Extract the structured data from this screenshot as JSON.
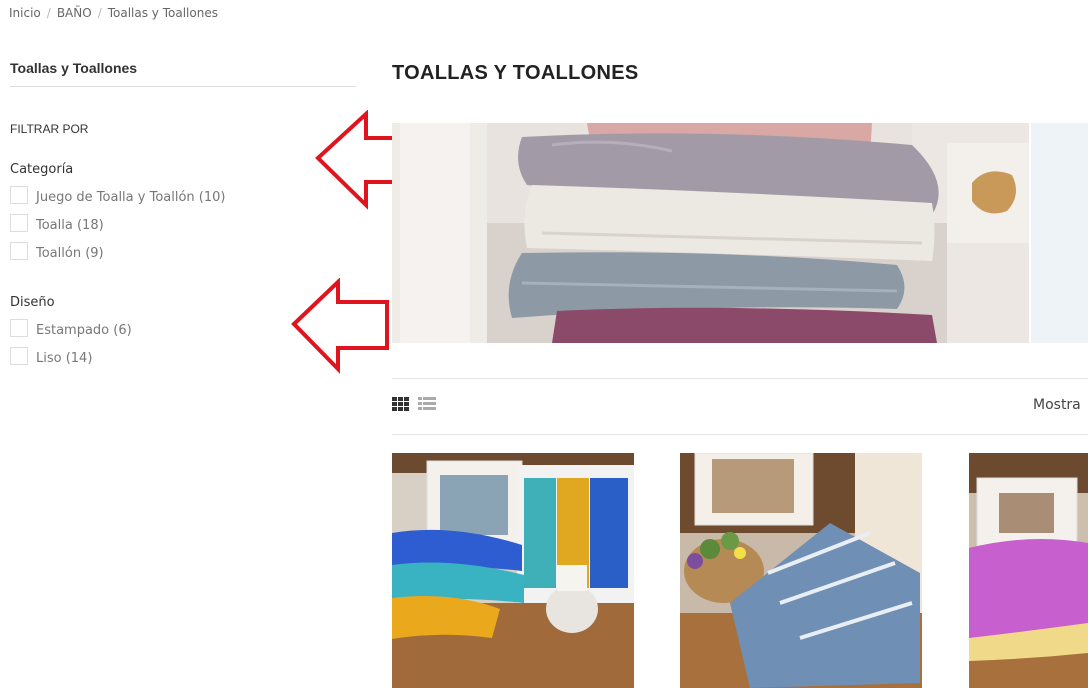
{
  "breadcrumb": {
    "items": [
      "Inicio",
      "BAÑO",
      "Toallas y Toallones"
    ],
    "separator": "/"
  },
  "sidebar": {
    "title": "Toallas y Toallones",
    "filter_heading": "FILTRAR POR",
    "groups": [
      {
        "label": "Categoría",
        "options": [
          {
            "label": "Juego de Toalla y Toallón (10)",
            "checked": false
          },
          {
            "label": "Toalla (18)",
            "checked": false
          },
          {
            "label": "Toallón (9)",
            "checked": false
          }
        ]
      },
      {
        "label": "Diseño",
        "options": [
          {
            "label": "Estampado (6)",
            "checked": false
          },
          {
            "label": "Liso (14)",
            "checked": false
          }
        ]
      }
    ]
  },
  "annotations": {
    "arrow_color": "#e0141e"
  },
  "main": {
    "title": "TOALLAS Y TOALLONES",
    "toolbar": {
      "view_icons": [
        "grid-view-icon",
        "list-view-icon"
      ],
      "show_label": "Mostra"
    },
    "products": [
      {
        "name": "product-1",
        "image": "towel-set-gift-box-photo"
      },
      {
        "name": "product-2",
        "image": "striped-blue-towels-photo"
      },
      {
        "name": "product-3",
        "image": "pink-towel-photo"
      }
    ]
  }
}
